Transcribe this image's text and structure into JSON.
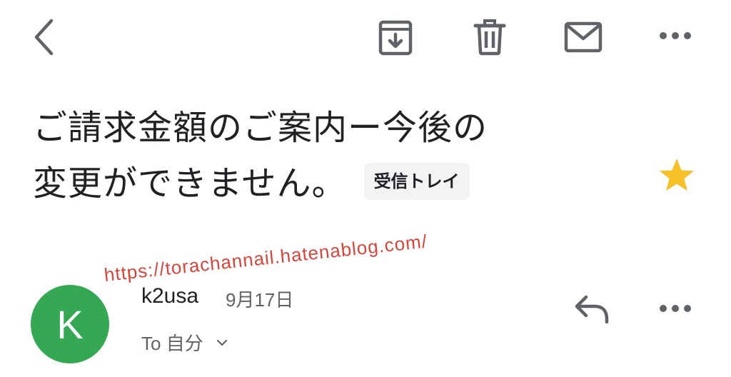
{
  "toolbar": {
    "back_icon": "chevron-left-icon",
    "archive_icon": "archive-icon",
    "delete_icon": "trash-icon",
    "mark_unread_icon": "mail-icon",
    "more_icon": "more-horizontal-icon",
    "icon_color": "#5f6368"
  },
  "subject": {
    "line1": "ご請求金額のご案内ー今後の",
    "line2": "変更ができません。",
    "label": "受信トレイ",
    "star_icon": "star-icon",
    "star_color": "#f6c026",
    "starred": true
  },
  "watermark": {
    "text": "https://torachannail.hatenablog.com/",
    "color": "#d8433b"
  },
  "message": {
    "avatar_letter": "K",
    "avatar_color": "#34a853",
    "sender": "k2usa",
    "date": "9月17日",
    "recipient": "To 自分",
    "reply_icon": "reply-icon",
    "more_icon": "more-horizontal-icon"
  }
}
